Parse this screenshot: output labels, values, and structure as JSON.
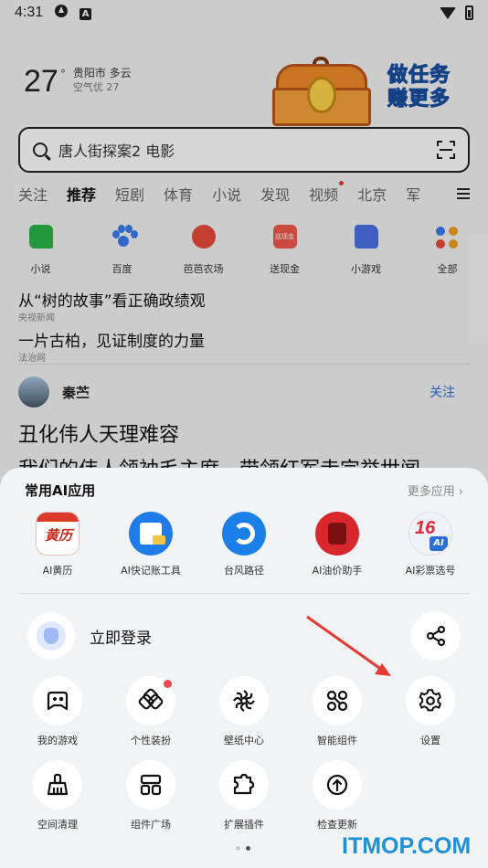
{
  "status_bar": {
    "time": "4:31"
  },
  "weather": {
    "temperature": "27",
    "degree": "°",
    "city_weather": "贵阳市 多云",
    "air_quality": "空气优 27"
  },
  "promo": {
    "text": "做任务赚更多"
  },
  "search": {
    "query": "唐人街探案2 电影"
  },
  "channels": [
    "关注",
    "推荐",
    "短剧",
    "体育",
    "小说",
    "发现",
    "视频",
    "北京",
    "军"
  ],
  "quick_links": [
    {
      "label": "小说",
      "icon": "novel-icon"
    },
    {
      "label": "百度",
      "icon": "baidu-paw-icon"
    },
    {
      "label": "芭芭农场",
      "icon": "farm-apple-icon"
    },
    {
      "label": "送现金",
      "icon": "cash-icon",
      "icon_text": "送现金"
    },
    {
      "label": "小游戏",
      "icon": "game-icon"
    },
    {
      "label": "全部",
      "icon": "all-apps-icon"
    }
  ],
  "news": [
    {
      "title": "从“树的故事”看正确政绩观",
      "source": "央视新闻"
    },
    {
      "title": "一片古柏，见证制度的力量",
      "source": "法治网"
    }
  ],
  "feed_author": {
    "name": "秦苎",
    "follow": "关注"
  },
  "article": {
    "title": "丑化伟人天理难容",
    "snippet": "我们的伟人领袖毛主席，带领红军走完举世闻"
  },
  "sheet": {
    "title": "常用AI应用",
    "more": "更多应用",
    "ai_apps": [
      {
        "label": "AI黄历",
        "icon": "huangli-icon",
        "icon_text": "黄历"
      },
      {
        "label": "AI快记账工具",
        "icon": "bookkeeping-icon"
      },
      {
        "label": "台风路径",
        "icon": "typhoon-icon"
      },
      {
        "label": "AI油价助手",
        "icon": "oil-price-icon"
      },
      {
        "label": "AI彩票选号",
        "icon": "lottery-icon",
        "icon_text": "16",
        "icon_badge": "AI"
      }
    ],
    "login": "立即登录",
    "tools_row1": [
      {
        "label": "我的游戏",
        "icon": "gamepad-icon"
      },
      {
        "label": "个性装扮",
        "icon": "theme-icon",
        "badge": true
      },
      {
        "label": "壁纸中心",
        "icon": "wallpaper-icon"
      },
      {
        "label": "智能组件",
        "icon": "widget-icon"
      },
      {
        "label": "设置",
        "icon": "settings-gear-icon"
      }
    ],
    "tools_row2": [
      {
        "label": "空间清理",
        "icon": "broom-icon"
      },
      {
        "label": "组件广场",
        "icon": "grid-layout-icon"
      },
      {
        "label": "扩展插件",
        "icon": "puzzle-icon"
      },
      {
        "label": "检查更新",
        "icon": "update-arrow-icon"
      }
    ]
  },
  "watermark": "ITMOP.COM",
  "colors": {
    "accent_blue": "#2b6fd6",
    "arrow_red": "#e53935",
    "badge_red": "#f04a4a",
    "watermark_blue": "#1f8fd6"
  }
}
